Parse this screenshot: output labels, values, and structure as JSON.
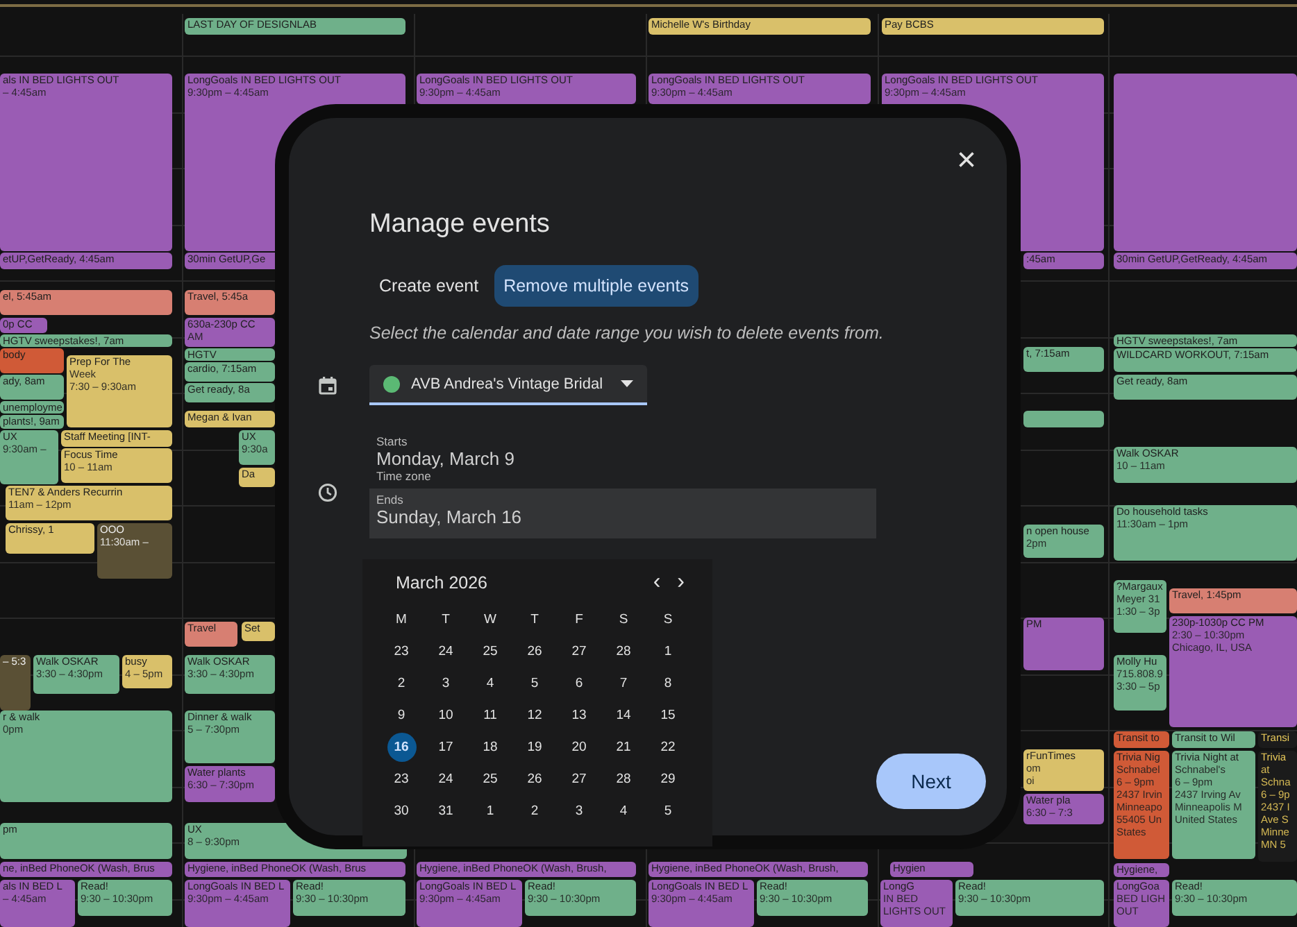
{
  "calendar": {
    "events": [
      {
        "lines": [
          "LAST DAY OF DESIGNLAB"
        ],
        "color": "#6fb08a"
      },
      {
        "lines": [
          "Michelle W's Birthday"
        ],
        "color": "#d9c06a"
      },
      {
        "lines": [
          "Pay BCBS"
        ],
        "color": "#d9c06a"
      },
      {
        "lines": [
          "als IN BED LIGHTS OUT",
          "– 4:45am"
        ],
        "color": "#9a5cb4"
      },
      {
        "lines": [
          "etUP,GetReady, 4:45am"
        ],
        "color": "#9a5cb4"
      },
      {
        "lines": [
          "el, 5:45am"
        ],
        "color": "#d77f72"
      },
      {
        "lines": [
          "0p CC"
        ],
        "color": "#9a5cb4"
      },
      {
        "lines": [
          "HGTV sweepstakes!, 7am"
        ],
        "color": "#6fb08a"
      },
      {
        "lines": [
          "body"
        ],
        "color": "#d05a37"
      },
      {
        "lines": [
          "ady, 8am"
        ],
        "color": "#6fb08a"
      },
      {
        "lines": [
          "unemployme"
        ],
        "color": "#6fb08a"
      },
      {
        "lines": [
          "plants!, 9am"
        ],
        "color": "#6fb08a"
      },
      {
        "lines": [
          "Prep For The",
          "Week",
          "7:30 – 9:30am"
        ],
        "color": "#d9c06a"
      },
      {
        "lines": [
          "UX",
          "9:30am –"
        ],
        "color": "#6fb08a"
      },
      {
        "lines": [
          "Staff Meeting [INT-"
        ],
        "color": "#d9c06a"
      },
      {
        "lines": [
          "Focus Time",
          "10 – 11am"
        ],
        "color": "#d9c06a"
      },
      {
        "lines": [
          "TEN7 & Anders Recurrin",
          "11am – 12pm"
        ],
        "color": "#d9c06a"
      },
      {
        "lines": [
          "Chrissy, 1"
        ],
        "color": "#d9c06a"
      },
      {
        "lines": [
          "OOO",
          "11:30am –"
        ],
        "color": "#5a5035"
      },
      {
        "lines": [
          "– 5:3"
        ],
        "color": "#5a5035"
      },
      {
        "lines": [
          "Walk OSKAR",
          "3:30 – 4:30pm"
        ],
        "color": "#6fb08a"
      },
      {
        "lines": [
          "busy",
          "4 – 5pm"
        ],
        "color": "#d9c06a"
      },
      {
        "lines": [
          "r & walk",
          "0pm"
        ],
        "color": "#6fb08a"
      },
      {
        "lines": [
          "pm"
        ],
        "color": "#6fb08a"
      },
      {
        "lines": [
          "ne, inBed PhoneOK (Wash, Brus"
        ],
        "color": "#9a5cb4"
      },
      {
        "lines": [
          "als IN BED L",
          "– 4:45am"
        ],
        "color": "#9a5cb4"
      },
      {
        "lines": [
          "Read!",
          "9:30 – 10:30pm"
        ],
        "color": "#6fb08a"
      },
      {
        "lines": [
          "LongGoals IN BED LIGHTS OUT",
          "9:30pm – 4:45am"
        ],
        "color": "#9a5cb4"
      },
      {
        "lines": [
          "30min GetUP,Ge"
        ],
        "color": "#9a5cb4"
      },
      {
        "lines": [
          "Travel, 5:45a"
        ],
        "color": "#d77f72"
      },
      {
        "lines": [
          "630a-230p CC",
          "AM"
        ],
        "color": "#9a5cb4"
      },
      {
        "lines": [
          "HGTV"
        ],
        "color": "#6fb08a"
      },
      {
        "lines": [
          "cardio, 7:15am"
        ],
        "color": "#6fb08a"
      },
      {
        "lines": [
          "Get ready, 8a"
        ],
        "color": "#6fb08a"
      },
      {
        "lines": [
          "Megan & Ivan"
        ],
        "color": "#d9c06a"
      },
      {
        "lines": [
          "UX",
          "9:30a"
        ],
        "color": "#6fb08a"
      },
      {
        "lines": [
          "Da"
        ],
        "color": "#d9c06a"
      },
      {
        "lines": [
          "Travel"
        ],
        "color": "#d77f72"
      },
      {
        "lines": [
          "Set"
        ],
        "color": "#d9c06a"
      },
      {
        "lines": [
          "Walk OSKAR",
          "3:30 – 4:30pm"
        ],
        "color": "#6fb08a"
      },
      {
        "lines": [
          "Dinner & walk",
          "5 – 7:30pm"
        ],
        "color": "#6fb08a"
      },
      {
        "lines": [
          "Water plants",
          "6:30 – 7:30pm"
        ],
        "color": "#9a5cb4"
      },
      {
        "lines": [
          "UX",
          "8 – 9:30pm"
        ],
        "color": "#6fb08a"
      },
      {
        "lines": [
          "Hygiene, inBed PhoneOK (Wash, Brus"
        ],
        "color": "#9a5cb4"
      },
      {
        "lines": [
          "LongGoals IN BED L",
          "9:30pm – 4:45am"
        ],
        "color": "#9a5cb4"
      },
      {
        "lines": [
          "Read!",
          "9:30 – 10:30pm"
        ],
        "color": "#6fb08a"
      },
      {
        "lines": [
          "LongGoals IN BED LIGHTS OUT",
          "9:30pm – 4:45am"
        ],
        "color": "#9a5cb4"
      },
      {
        "lines": [
          "Hygiene, inBed PhoneOK (Wash, Brush,"
        ],
        "color": "#9a5cb4"
      },
      {
        "lines": [
          "LongGoals IN BED L",
          "9:30pm – 4:45am"
        ],
        "color": "#9a5cb4"
      },
      {
        "lines": [
          "Read!",
          "9:30 – 10:30pm"
        ],
        "color": "#6fb08a"
      },
      {
        "lines": [
          "LongGoals IN BED LIGHTS OUT",
          "9:30pm – 4:45am"
        ],
        "color": "#9a5cb4"
      },
      {
        "lines": [
          "Hygiene, inBed PhoneOK (Wash, Brush,"
        ],
        "color": "#9a5cb4"
      },
      {
        "lines": [
          "LongGoals IN BED L",
          "9:30pm – 4:45am"
        ],
        "color": "#9a5cb4"
      },
      {
        "lines": [
          "Read!",
          "9:30 – 10:30pm"
        ],
        "color": "#6fb08a"
      },
      {
        "lines": [
          "LongGoals IN BED LIGHTS OUT",
          "9:30pm – 4:45am"
        ],
        "color": "#9a5cb4"
      },
      {
        "lines": [
          ":45am"
        ],
        "color": "#9a5cb4"
      },
      {
        "lines": [
          "t, 7:15am"
        ],
        "color": "#6fb08a"
      },
      {
        "color": "#6fb08a"
      },
      {
        "lines": [
          "n open house",
          "2pm"
        ],
        "color": "#6fb08a"
      },
      {
        "lines": [
          "PM"
        ],
        "color": "#9a5cb4"
      },
      {
        "lines": [
          "rFunTimes",
          "om",
          "oi"
        ],
        "color": "#d9c06a"
      },
      {
        "lines": [
          "Water pla",
          "6:30 – 7:3"
        ],
        "color": "#9a5cb4"
      },
      {
        "lines": [
          "Hygien"
        ],
        "color": "#9a5cb4"
      },
      {
        "lines": [
          "LongG",
          "IN BED",
          "LIGHTS OUT"
        ],
        "color": "#9a5cb4"
      },
      {
        "lines": [
          "Read!",
          "9:30 – 10:30pm"
        ],
        "color": "#6fb08a"
      },
      {
        "color": "#9a5cb4"
      },
      {
        "lines": [
          "30min GetUP,GetReady, 4:45am"
        ],
        "color": "#9a5cb4"
      },
      {
        "lines": [
          "HGTV sweepstakes!, 7am"
        ],
        "color": "#6fb08a"
      },
      {
        "lines": [
          "WILDCARD WORKOUT, 7:15am"
        ],
        "color": "#6fb08a"
      },
      {
        "lines": [
          "Get ready, 8am"
        ],
        "color": "#6fb08a"
      },
      {
        "lines": [
          "Walk OSKAR",
          "10 – 11am"
        ],
        "color": "#6fb08a"
      },
      {
        "lines": [
          "Do household tasks",
          "11:30am – 1pm"
        ],
        "color": "#6fb08a"
      },
      {
        "lines": [
          "?Margaux",
          "Meyer 31",
          "1:30 – 3p"
        ],
        "color": "#6fb08a"
      },
      {
        "lines": [
          "Travel, 1:45pm"
        ],
        "color": "#d77f72"
      },
      {
        "lines": [
          "230p-1030p CC PM",
          "2:30 – 10:30pm",
          "Chicago, IL, USA"
        ],
        "color": "#9a5cb4"
      },
      {
        "lines": [
          "Molly Hu",
          "715.808.9",
          "3:30 – 5p"
        ],
        "color": "#6fb08a"
      },
      {
        "lines": [
          "Transit to"
        ],
        "color": "#d05a37"
      },
      {
        "lines": [
          "Trivia Nig",
          "Schnabel",
          "6 – 9pm",
          "2437 Irvin",
          "Minneapo",
          "55405 Un",
          "States"
        ],
        "color": "#d05a37"
      },
      {
        "lines": [
          "Transit to Wil"
        ],
        "color": "#6fb08a"
      },
      {
        "lines": [
          "Transi"
        ],
        "color": "#1b1b1b"
      },
      {
        "lines": [
          "Trivia Night at",
          "Schnabel's",
          "6 – 9pm",
          "2437 Irving Av",
          "Minneapolis M",
          "United States"
        ],
        "color": "#6fb08a"
      },
      {
        "lines": [
          "Trivia",
          "at",
          "Schna",
          "6 – 9p",
          "2437 I",
          "Ave S",
          "Minne",
          "MN 5"
        ],
        "color": "#1b1b1b"
      },
      {
        "lines": [
          "Hygiene,"
        ],
        "color": "#9a5cb4"
      },
      {
        "lines": [
          "LongGoa",
          "BED LIGH",
          "OUT"
        ],
        "color": "#9a5cb4"
      },
      {
        "lines": [
          "Read!",
          "9:30 – 10:30pm"
        ],
        "color": "#6fb08a"
      }
    ]
  },
  "dialog": {
    "title": "Manage events",
    "close": "×",
    "tabs": [
      {
        "label": "Create event",
        "selected": false
      },
      {
        "label": "Remove multiple events",
        "selected": true
      }
    ],
    "instructions": "Select the calendar and date range you wish to delete events from.",
    "calendar_select": {
      "value": "AVB Andrea's Vintage Bridal",
      "color": "#5bb974"
    },
    "start": {
      "label": "Starts",
      "value": "Monday, March 9",
      "note": "Time zone"
    },
    "end": {
      "label": "Ends",
      "value": "Sunday, March 16"
    },
    "date_picker": {
      "month": "March 2026",
      "prev": "‹",
      "next": "›",
      "weekdays": [
        "M",
        "T",
        "W",
        "T",
        "F",
        "S",
        "S"
      ],
      "weeks": [
        [
          {
            "day": "23",
            "selected": false
          },
          {
            "day": "24",
            "selected": false
          },
          {
            "day": "25",
            "selected": false
          },
          {
            "day": "26",
            "selected": false
          },
          {
            "day": "27",
            "selected": false
          },
          {
            "day": "28",
            "selected": false
          },
          {
            "day": "1",
            "selected": false
          }
        ],
        [
          {
            "day": "2",
            "selected": false
          },
          {
            "day": "3",
            "selected": false
          },
          {
            "day": "4",
            "selected": false
          },
          {
            "day": "5",
            "selected": false
          },
          {
            "day": "6",
            "selected": false
          },
          {
            "day": "7",
            "selected": false
          },
          {
            "day": "8",
            "selected": false
          }
        ],
        [
          {
            "day": "9",
            "selected": false
          },
          {
            "day": "10",
            "selected": false
          },
          {
            "day": "11",
            "selected": false
          },
          {
            "day": "12",
            "selected": false
          },
          {
            "day": "13",
            "selected": false
          },
          {
            "day": "14",
            "selected": false
          },
          {
            "day": "15",
            "selected": false
          }
        ],
        [
          {
            "day": "16",
            "selected": true
          },
          {
            "day": "17",
            "selected": false
          },
          {
            "day": "18",
            "selected": false
          },
          {
            "day": "19",
            "selected": false
          },
          {
            "day": "20",
            "selected": false
          },
          {
            "day": "21",
            "selected": false
          },
          {
            "day": "22",
            "selected": false
          }
        ],
        [
          {
            "day": "23",
            "selected": false
          },
          {
            "day": "24",
            "selected": false
          },
          {
            "day": "25",
            "selected": false
          },
          {
            "day": "26",
            "selected": false
          },
          {
            "day": "27",
            "selected": false
          },
          {
            "day": "28",
            "selected": false
          },
          {
            "day": "29",
            "selected": false
          }
        ],
        [
          {
            "day": "30",
            "selected": false
          },
          {
            "day": "31",
            "selected": false
          },
          {
            "day": "1",
            "selected": false
          },
          {
            "day": "2",
            "selected": false
          },
          {
            "day": "3",
            "selected": false
          },
          {
            "day": "4",
            "selected": false
          },
          {
            "day": "5",
            "selected": false
          }
        ]
      ]
    },
    "next_button": "Next"
  }
}
